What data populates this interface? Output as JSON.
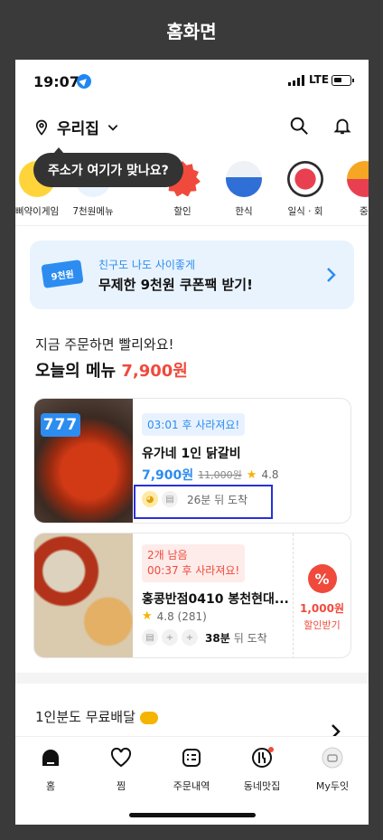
{
  "frame_title": "홈화면",
  "status": {
    "time": "19:07",
    "network": "LTE"
  },
  "header": {
    "address": "우리집"
  },
  "tooltip": "주소가 여기가 맞나요?",
  "categories": [
    {
      "label": "삐약이게임"
    },
    {
      "label": "7천원메뉴"
    },
    {
      "label": "할인"
    },
    {
      "label": "한식"
    },
    {
      "label": "일식 · 회"
    },
    {
      "label": "중"
    }
  ],
  "banner": {
    "ticket": "9천원",
    "subtitle": "친구도 나도 사이좋게",
    "title": "무제한 9천원 쿠폰팩 받기!"
  },
  "section": {
    "subtitle": "지금 주문하면 빨리와요!",
    "title": "오늘의 메뉴",
    "title_price": "7,900원"
  },
  "cards": [
    {
      "badge": "777",
      "timer": "03:01 후 사라져요!",
      "name": "유가네 1인 닭갈비",
      "price": "7,900원",
      "old_price": "11,000원",
      "rating": "4.8",
      "eta": "26분 뒤 도착"
    },
    {
      "remaining": "2개 남음",
      "timer": "00:37 후 사라져요!",
      "name": "홍콩반점0410 봉천현대...",
      "rating": "4.8 (281)",
      "eta_bold": "38분",
      "eta": "뒤 도착",
      "coupon_amount": "1,000원",
      "coupon_label": "할인받기"
    }
  ],
  "free_delivery": {
    "title": "1인분도 무료배달"
  },
  "tabs": [
    {
      "label": "홈",
      "icon": "home-icon"
    },
    {
      "label": "찜",
      "icon": "heart-icon"
    },
    {
      "label": "주문내역",
      "icon": "receipt-icon"
    },
    {
      "label": "동네맛집",
      "icon": "restaurant-icon"
    },
    {
      "label": "My두잇",
      "icon": "profile-icon"
    }
  ],
  "colors": {
    "accent": "#2d8cf0",
    "sale": "#f04a3c",
    "highlight_box": "#2730d8"
  }
}
